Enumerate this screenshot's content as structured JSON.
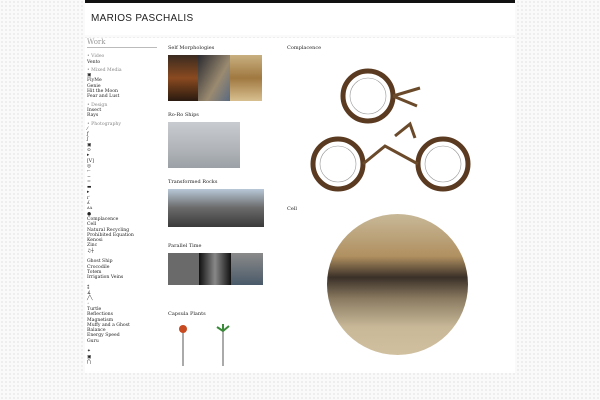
{
  "header": {
    "title": "MARIOS PASCHALIS"
  },
  "sidebar": {
    "heading": "Work",
    "categories": [
      {
        "label": "• Video",
        "items": [
          "Vento"
        ]
      },
      {
        "label": "• Mixed Media",
        "items": [
          "▣",
          "FlyMe",
          "Genie",
          "Hit the Moon",
          "Fear and Lust"
        ]
      },
      {
        "label": "• Design",
        "items": [
          "Insect",
          "Rays"
        ]
      },
      {
        "label": "• Photography",
        "items": [
          "⁄",
          "ƒ",
          "ʃ",
          "▣",
          "⊙",
          "▸",
          "[V]",
          "◎",
          "⌐",
          "−",
          "=",
          "▬",
          "▸",
          "ґ",
          "ʎ",
          "ʌʌ",
          "●",
          "Complacence",
          "Cell",
          "Natural Recycling",
          "Prohibited Equation",
          "Kenosi",
          "Zinc",
          "♫┼",
          "",
          "Ghost Ship",
          "Crocodile",
          "Totem",
          "Irrigation Veins",
          "",
          "⁑",
          "∡",
          "╱╲",
          "◦",
          "Turtle",
          "Reflections",
          "Magnetism",
          "Muffy and a Ghost",
          "Balance",
          "Energy Speed",
          "Guru",
          "",
          "✦",
          "▣",
          "⋂"
        ]
      }
    ]
  },
  "middle": [
    {
      "title": "Self Morphologies"
    },
    {
      "title": "Ro-Ro Ships"
    },
    {
      "title": "Transformed Rocks"
    },
    {
      "title": "Parallel Time"
    },
    {
      "title": "Capsula Plants"
    }
  ],
  "right": [
    {
      "title": "Complacence"
    },
    {
      "title": "Cell"
    }
  ]
}
